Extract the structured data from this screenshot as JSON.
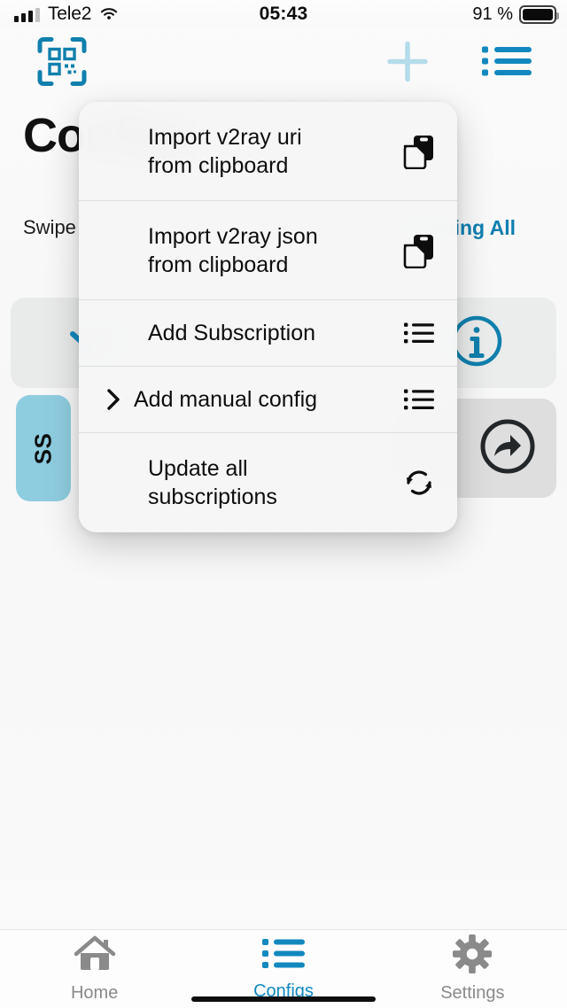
{
  "status_bar": {
    "carrier": "Tele2",
    "time": "05:43",
    "battery_percent": "91 %",
    "signal_icon": "signal-bars-icon",
    "wifi_icon": "wifi-icon",
    "battery_icon": "battery-icon"
  },
  "navbar": {
    "qr_icon": "qr-scan-icon",
    "add_icon": "plus-icon",
    "list_icon": "list-bullet-icon"
  },
  "page": {
    "title": "Configs",
    "swipe_hint": "Swipe",
    "showing_all": "Showing All",
    "badge_label": "SS",
    "chevron_icon": "chevron-down-icon",
    "info_icon": "info-circle-icon",
    "share_icon": "share-circle-icon"
  },
  "context_menu": {
    "items": [
      {
        "label": "Import v2ray uri\nfrom clipboard",
        "icon": "clipboard-doc-icon",
        "has_submenu": false,
        "tall": true
      },
      {
        "label": "Import v2ray json\nfrom clipboard",
        "icon": "clipboard-doc-icon",
        "has_submenu": false,
        "tall": true
      },
      {
        "label": "Add Subscription",
        "icon": "list-bullet-icon",
        "has_submenu": false,
        "tall": false
      },
      {
        "label": "Add manual config",
        "icon": "list-bullet-icon",
        "has_submenu": true,
        "tall": false
      },
      {
        "label": "Update all\nsubscriptions",
        "icon": "refresh-icon",
        "has_submenu": false,
        "tall": true
      }
    ]
  },
  "tabbar": {
    "tabs": [
      {
        "label": "Home",
        "icon": "home-icon",
        "active": false
      },
      {
        "label": "Configs",
        "icon": "list-bullet-icon",
        "active": true
      },
      {
        "label": "Settings",
        "icon": "gear-icon",
        "active": false
      }
    ]
  },
  "colors": {
    "accent": "#1288bf",
    "accent_dim": "#b4dcea",
    "badge_bg": "#8ecde0",
    "tab_inactive": "#8a8a8a"
  }
}
